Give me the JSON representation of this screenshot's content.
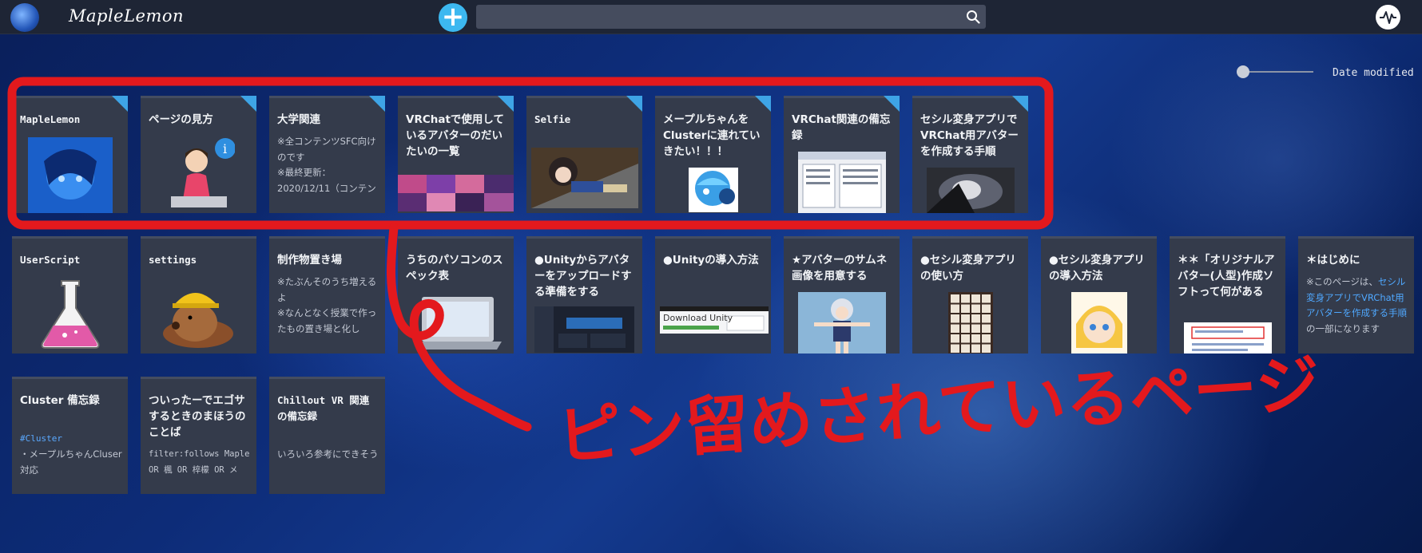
{
  "header": {
    "brand": "MapleLemon",
    "search_placeholder": "",
    "colors": {
      "bar": "#1e2535",
      "add_button": "#3cb8f0",
      "search_bg": "#454c5e"
    }
  },
  "sort": {
    "label": "Date modified"
  },
  "pinned_rows": [
    [
      {
        "title": "MapleLemon",
        "mono": true,
        "pinned": true,
        "image": "anime-avatar"
      },
      {
        "title": "ページの見方",
        "pinned": true,
        "image": "guide-woman-info"
      },
      {
        "title": "大学関連",
        "pinned": true,
        "desc": [
          "※全コンテンツSFC向けのです",
          "※最終更新：",
          "2020/12/11（コンテン"
        ]
      },
      {
        "title": "VRChatで使用しているアバターのだいたいの一覧",
        "pinned": true,
        "image": "avatar-collage"
      },
      {
        "title": "Selfie",
        "mono": true,
        "pinned": true,
        "image": "selfie-screenshot"
      },
      {
        "title": "メープルちゃんをClusterに連れていきたい！！！",
        "pinned": true,
        "image": "blue-ball-character"
      },
      {
        "title": "VRChat関連の備忘録",
        "pinned": true,
        "image": "settings-window"
      },
      {
        "title": "セシル変身アプリでVRChat用アバターを作成する手順",
        "pinned": true,
        "image": "dark-photo"
      }
    ],
    [
      {
        "title": "UserScript",
        "mono": true,
        "image": "flask"
      },
      {
        "title": "settings",
        "mono": true,
        "image": "mole-helmet"
      },
      {
        "title": "制作物置き場",
        "desc": [
          "※たぶんそのうち増えるよ",
          "※なんとなく授業で作ったもの置き場と化し"
        ]
      },
      {
        "title": "うちのパソコンのスペック表",
        "image": "laptop"
      },
      {
        "title": "●Unityからアバターをアップロードする準備をする",
        "image": "unity-dark-ui"
      },
      {
        "title": "●Unityの導入方法",
        "image": "download-unity",
        "image_text": "Download Unity"
      },
      {
        "title": "★アバターのサムネ画像を用意する",
        "image": "anime-3d-girl"
      },
      {
        "title": "●セシル変身アプリの使い方",
        "image": "key-grid"
      },
      {
        "title": "●セシル変身アプリの導入方法",
        "image": "anime-face"
      },
      {
        "title": "＊＊「オリジナルアバター(人型)作成ソフトって何があるの？」",
        "image": "webpage-red"
      },
      {
        "title": "＊はじめに",
        "desc_parts": [
          {
            "t": "※このページは、",
            "link": false
          },
          {
            "t": "セシル変身アプリでVRChat用アバターを作成する手順",
            "link": true
          },
          {
            "t": "の一部になります",
            "link": false
          }
        ]
      }
    ],
    [
      {
        "title": "Cluster 備忘録",
        "hashtag": "#Cluster",
        "desc": [
          "・メープルちゃんCluser対応"
        ]
      },
      {
        "title": "ついったーでエゴサするときのまほうのことば",
        "mono_desc": [
          "filter:follows Maple",
          "OR 楓 OR 椊檬 OR メ"
        ]
      },
      {
        "title": "Chillout VR 関連の備忘録",
        "mono_title": true,
        "desc": [
          "いろいろ参考にできそう"
        ]
      }
    ]
  ],
  "annotation": {
    "text": "ピン留めされているページ",
    "color": "#e3191d"
  }
}
